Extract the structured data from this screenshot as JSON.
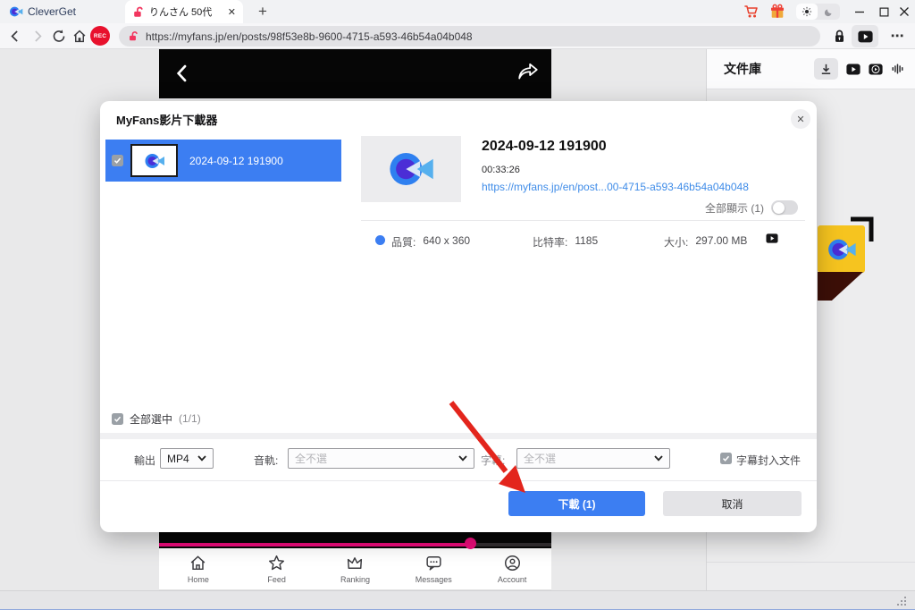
{
  "app": {
    "name": "CleverGet"
  },
  "titlebar": {
    "tab_title": "りんさん 50代"
  },
  "icons": {
    "close": "✕",
    "plus": "+",
    "more": "⋯",
    "rec": "REC"
  },
  "toolbar": {
    "url": "https://myfans.jp/en/posts/98f53e8b-9600-4715-a593-46b54a04b048"
  },
  "library": {
    "title": "文件庫"
  },
  "site_nav": {
    "items": [
      {
        "label": "Home"
      },
      {
        "label": "Feed"
      },
      {
        "label": "Ranking"
      },
      {
        "label": "Messages"
      },
      {
        "label": "Account"
      }
    ]
  },
  "dialog": {
    "title": "MyFans影片下載器",
    "list_item": {
      "title": "2024-09-12 191900"
    },
    "detail": {
      "title": "2024-09-12 191900",
      "duration": "00:33:26",
      "link": "https://myfans.jp/en/post...00-4715-a593-46b54a04b048",
      "show_all": "全部顯示 (1)",
      "quality_label": "品質:",
      "quality_value": "640 x 360",
      "bitrate_label": "比特率:",
      "bitrate_value": "1185",
      "size_label": "大小:",
      "size_value": "297.00 MB"
    },
    "select_all": {
      "label": "全部選中",
      "count": "(1/1)"
    },
    "controls": {
      "output_label": "輸出",
      "output_value": "MP4",
      "audio_label": "音軌:",
      "audio_value": "全不選",
      "subtitle_label": "字幕:",
      "subtitle_value": "全不選",
      "embed_label": "字幕封入文件"
    },
    "buttons": {
      "download": "下載 (1)",
      "cancel": "取消"
    }
  },
  "colors": {
    "accent_blue": "#3c7ef2",
    "progress_pink": "#ee0c7c",
    "arrow_red": "#e3251c",
    "brand_yellow": "#f6c41f",
    "link_blue": "#3f8ce8"
  }
}
